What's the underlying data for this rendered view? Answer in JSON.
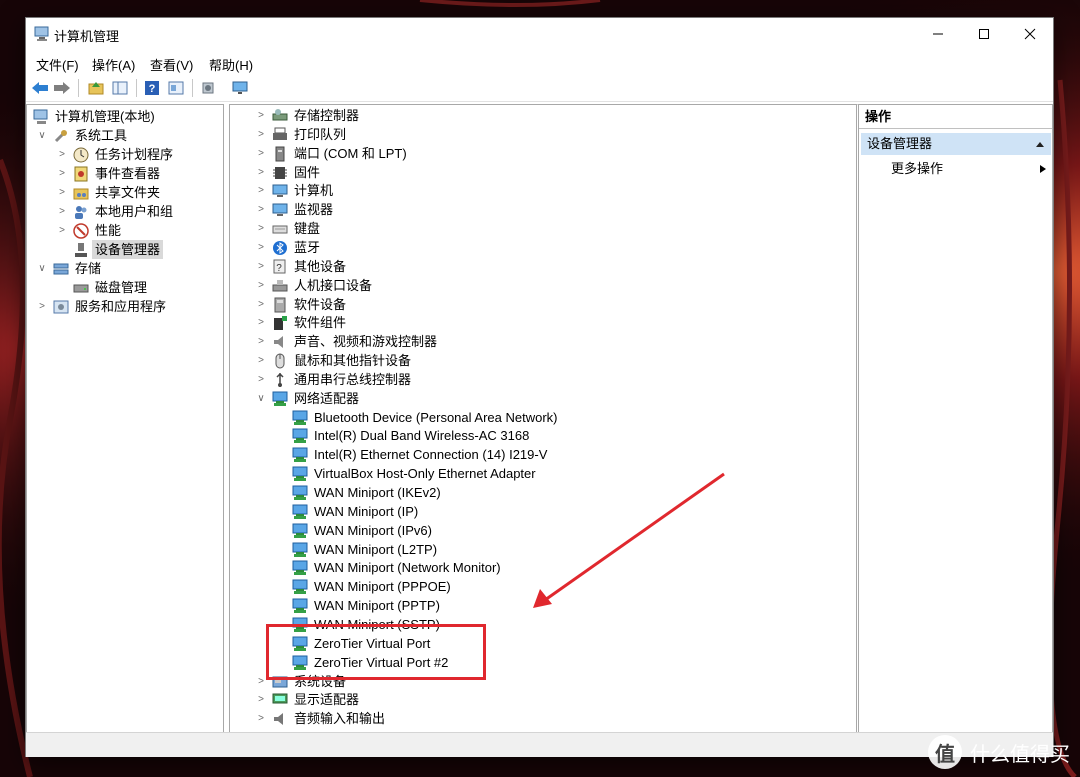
{
  "window": {
    "title": "计算机管理"
  },
  "menu": [
    "文件(F)",
    "操作(A)",
    "查看(V)",
    "帮助(H)"
  ],
  "toolbar": [
    "back-icon",
    "forward-icon",
    "up-folder-icon",
    "show-tree-icon",
    "help-icon",
    "properties-icon",
    "export-icon",
    "monitor-icon"
  ],
  "left_tree": [
    {
      "label": "计算机管理(本地)",
      "icon": "computer-management-icon",
      "expander": "",
      "selected": false
    },
    {
      "label": "系统工具",
      "icon": "tools-icon",
      "expander": "∨",
      "selected": false
    },
    {
      "label": "任务计划程序",
      "icon": "clock-icon",
      "expander": ">",
      "selected": false
    },
    {
      "label": "事件查看器",
      "icon": "event-viewer-icon",
      "expander": ">",
      "selected": false
    },
    {
      "label": "共享文件夹",
      "icon": "shared-folder-icon",
      "expander": ">",
      "selected": false
    },
    {
      "label": "本地用户和组",
      "icon": "users-icon",
      "expander": ">",
      "selected": false
    },
    {
      "label": "性能",
      "icon": "performance-icon",
      "expander": ">",
      "selected": false
    },
    {
      "label": "设备管理器",
      "icon": "device-manager-icon",
      "expander": "",
      "selected": true
    },
    {
      "label": "存储",
      "icon": "storage-icon",
      "expander": "∨",
      "selected": false
    },
    {
      "label": "磁盘管理",
      "icon": "disk-icon",
      "expander": "",
      "selected": false
    },
    {
      "label": "服务和应用程序",
      "icon": "services-icon",
      "expander": ">",
      "selected": false
    }
  ],
  "device_tree": [
    {
      "label": "存储控制器",
      "icon": "storage-controller-icon",
      "expander": ">"
    },
    {
      "label": "打印队列",
      "icon": "printer-icon",
      "expander": ">"
    },
    {
      "label": "端口 (COM 和 LPT)",
      "icon": "port-icon",
      "expander": ">"
    },
    {
      "label": "固件",
      "icon": "firmware-icon",
      "expander": ">"
    },
    {
      "label": "计算机",
      "icon": "computer-icon",
      "expander": ">"
    },
    {
      "label": "监视器",
      "icon": "monitor-icon",
      "expander": ">"
    },
    {
      "label": "键盘",
      "icon": "keyboard-icon",
      "expander": ">"
    },
    {
      "label": "蓝牙",
      "icon": "bluetooth-icon",
      "expander": ">"
    },
    {
      "label": "其他设备",
      "icon": "other-device-icon",
      "expander": ">"
    },
    {
      "label": "人机接口设备",
      "icon": "hid-icon",
      "expander": ">"
    },
    {
      "label": "软件设备",
      "icon": "software-device-icon",
      "expander": ">"
    },
    {
      "label": "软件组件",
      "icon": "software-component-icon",
      "expander": ">"
    },
    {
      "label": "声音、视频和游戏控制器",
      "icon": "speaker-icon",
      "expander": ">"
    },
    {
      "label": "鼠标和其他指针设备",
      "icon": "mouse-icon",
      "expander": ">"
    },
    {
      "label": "通用串行总线控制器",
      "icon": "usb-icon",
      "expander": ">"
    },
    {
      "label": "网络适配器",
      "icon": "network-adapter-icon",
      "expander": "∨"
    },
    {
      "label": "Bluetooth Device (Personal Area Network)",
      "icon": "network-adapter-icon",
      "expander": "",
      "child": true
    },
    {
      "label": "Intel(R) Dual Band Wireless-AC 3168",
      "icon": "network-adapter-icon",
      "expander": "",
      "child": true
    },
    {
      "label": "Intel(R) Ethernet Connection (14) I219-V",
      "icon": "network-adapter-icon",
      "expander": "",
      "child": true
    },
    {
      "label": "VirtualBox Host-Only Ethernet Adapter",
      "icon": "network-adapter-icon",
      "expander": "",
      "child": true
    },
    {
      "label": "WAN Miniport (IKEv2)",
      "icon": "network-adapter-icon",
      "expander": "",
      "child": true
    },
    {
      "label": "WAN Miniport (IP)",
      "icon": "network-adapter-icon",
      "expander": "",
      "child": true
    },
    {
      "label": "WAN Miniport (IPv6)",
      "icon": "network-adapter-icon",
      "expander": "",
      "child": true
    },
    {
      "label": "WAN Miniport (L2TP)",
      "icon": "network-adapter-icon",
      "expander": "",
      "child": true
    },
    {
      "label": "WAN Miniport (Network Monitor)",
      "icon": "network-adapter-icon",
      "expander": "",
      "child": true
    },
    {
      "label": "WAN Miniport (PPPOE)",
      "icon": "network-adapter-icon",
      "expander": "",
      "child": true
    },
    {
      "label": "WAN Miniport (PPTP)",
      "icon": "network-adapter-icon",
      "expander": "",
      "child": true
    },
    {
      "label": "WAN Miniport (SSTP)",
      "icon": "network-adapter-icon",
      "expander": "",
      "child": true
    },
    {
      "label": "ZeroTier Virtual Port",
      "icon": "network-adapter-icon",
      "expander": "",
      "child": true
    },
    {
      "label": "ZeroTier Virtual Port #2",
      "icon": "network-adapter-icon",
      "expander": "",
      "child": true
    },
    {
      "label": "系统设备",
      "icon": "system-device-icon",
      "expander": ">"
    },
    {
      "label": "显示适配器",
      "icon": "display-adapter-icon",
      "expander": ">"
    },
    {
      "label": "音频输入和输出",
      "icon": "audio-icon",
      "expander": ">"
    }
  ],
  "actions": {
    "header": "操作",
    "selected": "设备管理器",
    "more": "更多操作"
  },
  "watermark": {
    "logo": "值",
    "text": "什么值得买"
  },
  "colors": {
    "accent": "#0078d4",
    "highlight_box": "#e0282e",
    "annotation_arrow": "#e0282e",
    "selection": "#cfe3f6"
  }
}
